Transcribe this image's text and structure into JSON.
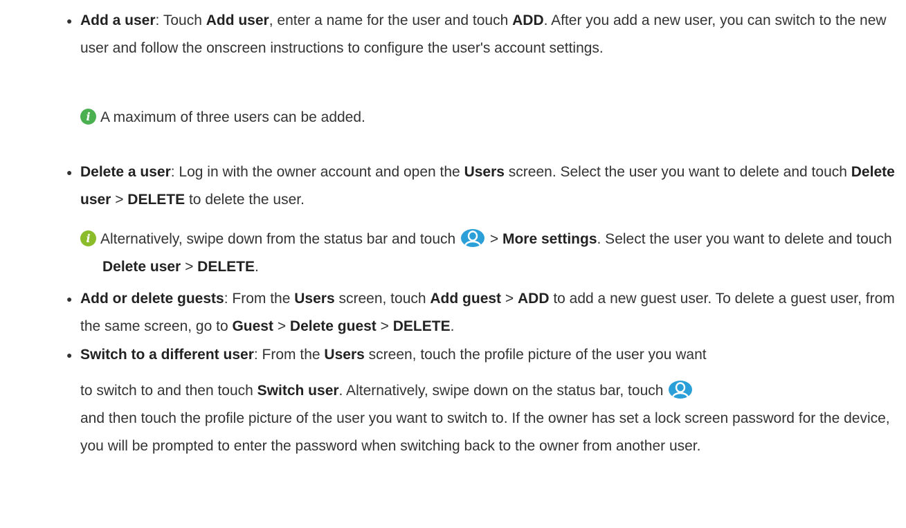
{
  "bullet_glyph": "●",
  "items": {
    "add_user": {
      "title": "Add a user",
      "colon": ":",
      "t1": " Touch ",
      "b1": "Add user",
      "t2": ", enter a name for the user and touch ",
      "b2": "ADD",
      "t3": ". After you add a new user, you can switch to the new user and follow the onscreen instructions to configure the user's account settings.",
      "note": "A maximum of three users can be added."
    },
    "delete_user": {
      "title": "Delete a user",
      "colon": ":",
      "t1": " Log in with the owner account and open the ",
      "b1": "Users",
      "t2": " screen. Select the user you want to delete and touch ",
      "b2": "Delete user",
      "t3": " > ",
      "b3": "DELETE",
      "t4": " to delete the user.",
      "note_t1": "Alternatively, swipe down from the status bar and touch ",
      "note_t2": " > ",
      "note_b1": "More settings",
      "note_t3": ". Select the user you want to delete and touch ",
      "note_b2": "Delete user",
      "note_t4": " > ",
      "note_b3": "DELETE",
      "note_t5": "."
    },
    "guests": {
      "title": "Add or delete guests",
      "colon": ":",
      "t1": " From the ",
      "b1": "Users",
      "t2": " screen, touch ",
      "b2": "Add guest",
      "t3": " > ",
      "b3": "ADD",
      "t4": " to add a new guest user. To delete a guest user, from the same screen, go to ",
      "b4": "Guest",
      "t5": " > ",
      "b5": "Delete guest",
      "t6": " > ",
      "b6": "DELETE",
      "t7": "."
    },
    "switch_user": {
      "title": "Switch to a different user",
      "colon": ":",
      "t1": " From the ",
      "b1": "Users",
      "t2": " screen, touch the profile picture of the user you want",
      "t3": "to switch to and then touch ",
      "b2": "Switch user",
      "t4": ". Alternatively, swipe down on the status bar, touch ",
      "t5": "and then touch the profile picture of the user you want to switch to. If the owner has set a lock screen password for the device, you will be prompted to enter the password when switching back to the owner from another user."
    }
  },
  "icons": {
    "note_icon": "info-icon",
    "user_icon": "user-profile-icon"
  },
  "colors": {
    "text": "#333333",
    "note_green": "#4bb050",
    "note_yellow": "#8bbd2a",
    "user_icon_blue": "#2a9fd8"
  }
}
